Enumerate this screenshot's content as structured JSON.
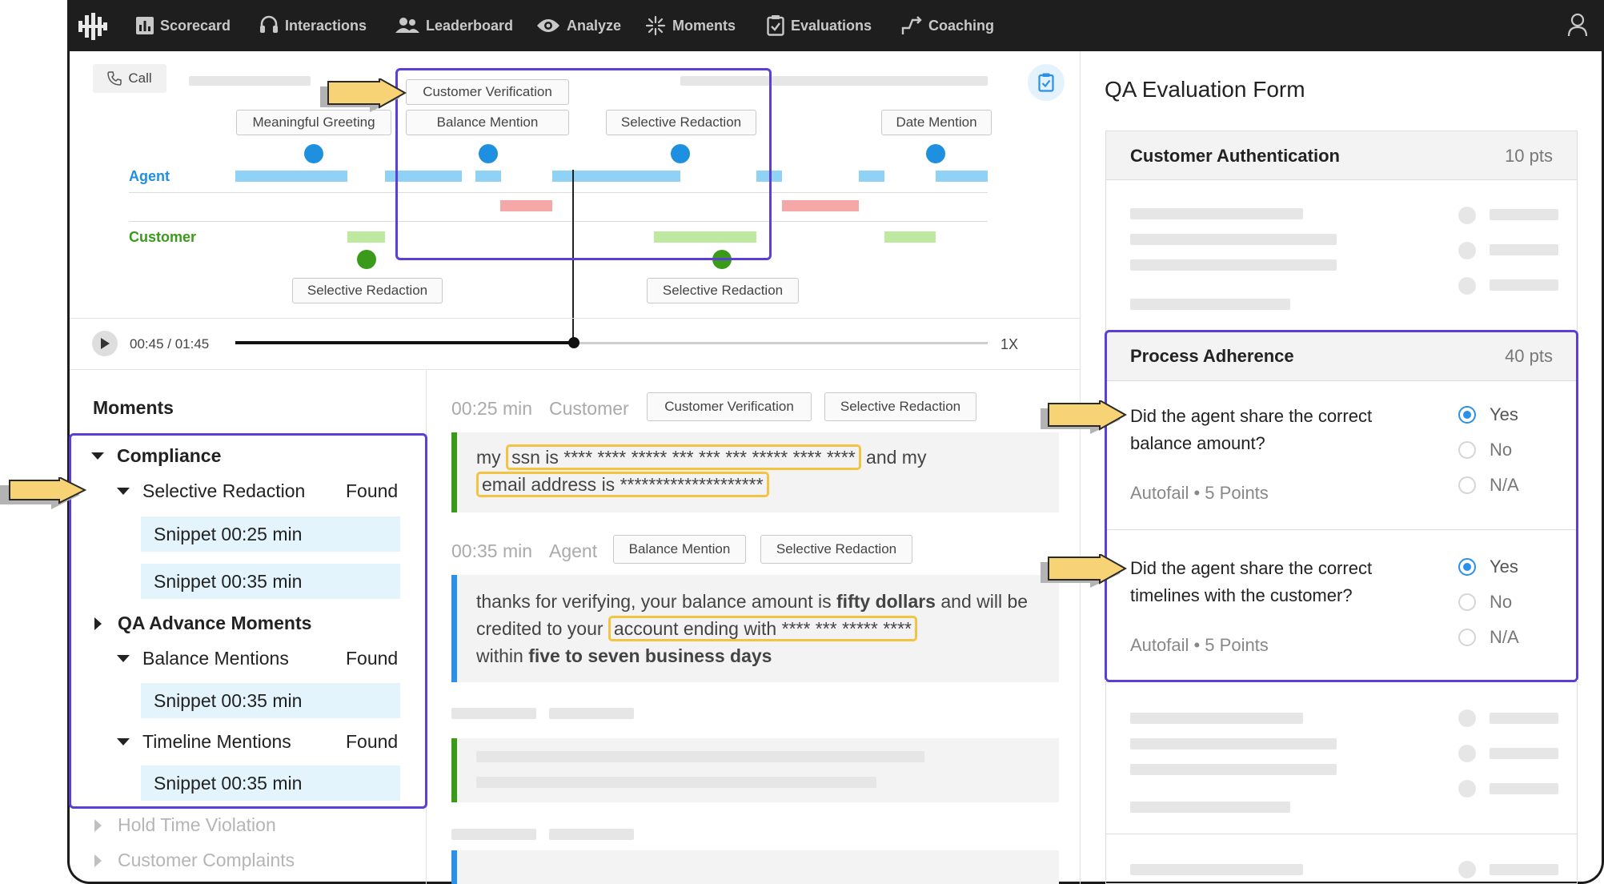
{
  "nav": {
    "items": [
      {
        "label": "Scorecard",
        "icon": "bar-chart-icon"
      },
      {
        "label": "Interactions",
        "icon": "headset-icon"
      },
      {
        "label": "Leaderboard",
        "icon": "people-icon"
      },
      {
        "label": "Analyze",
        "icon": "eye-icon"
      },
      {
        "label": "Moments",
        "icon": "sparkle-icon"
      },
      {
        "label": "Evaluations",
        "icon": "clipboard-check-icon"
      },
      {
        "label": "Coaching",
        "icon": "trend-line-icon"
      }
    ],
    "user_icon": "user-icon"
  },
  "timeline": {
    "call_label": "Call",
    "tags_top": {
      "customer_verification": "Customer Verification",
      "meaningful_greeting": "Meaningful Greeting",
      "balance_mention": "Balance Mention",
      "selective_redaction": "Selective Redaction",
      "date_mention": "Date Mention"
    },
    "tags_bottom": {
      "left": "Selective Redaction",
      "right": "Selective Redaction"
    },
    "agent_label": "Agent",
    "customer_label": "Customer",
    "agent_color": "#1f8fe0",
    "customer_color": "#3a9a1a"
  },
  "player": {
    "time": "00:45 / 01:45",
    "speed": "1X",
    "progress": 0.45
  },
  "moments": {
    "title": "Moments",
    "compliance": "Compliance",
    "selective_redaction": "Selective Redaction",
    "found": "Found",
    "snippet_025": "Snippet 00:25 min",
    "snippet_035": "Snippet 00:35 min",
    "qa_advance": "QA Advance Moments",
    "balance_mentions": "Balance Mentions",
    "timeline_mentions": "Timeline Mentions",
    "hold_time": "Hold Time Violation",
    "complaints": "Customer Complaints"
  },
  "transcript": {
    "msg1": {
      "time": "00:25 min",
      "speaker": "Customer",
      "tag1": "Customer Verification",
      "tag2": "Selective Redaction",
      "t1": "my ",
      "hl1": "ssn is **** **** ***** *** *** *** ***** **** ****",
      "t2": " and my",
      "hl2": "email address is  ********************"
    },
    "msg2": {
      "time": "00:35 min",
      "speaker": "Agent",
      "tag1": "Balance Mention",
      "tag2": "Selective Redaction",
      "t1": "thanks for verifying, your balance amount is ",
      "b1": "fifty dollars",
      "t2": " and will be credited to your ",
      "hl1": "account ending with **** *** ***** ****",
      "t3": " within ",
      "b2": "five to seven business days"
    }
  },
  "qa": {
    "title": "QA Evaluation Form",
    "auth": {
      "name": "Customer Authentication",
      "pts": "10 pts"
    },
    "process": {
      "name": "Process Adherence",
      "pts": "40 pts"
    },
    "q1": {
      "text": "Did the agent share the correct balance amount?",
      "meta": "Autofail • 5 Points"
    },
    "q2": {
      "text": "Did the agent share the correct timelines with the customer?",
      "meta": "Autofail • 5 Points"
    },
    "options": {
      "yes": "Yes",
      "no": "No",
      "na": "N/A"
    }
  }
}
